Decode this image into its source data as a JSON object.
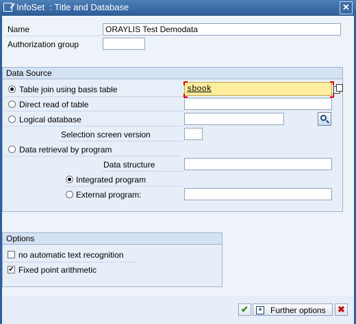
{
  "window": {
    "title": "InfoSet  : Title and Database",
    "close_symbol": "✕"
  },
  "header": {
    "name_label": "Name",
    "name_value": "ORAYLIS Test Demodata",
    "auth_label": "Authorization group",
    "auth_value": ""
  },
  "data_source": {
    "title": "Data Source",
    "table_join": {
      "label": "Table join using basis table",
      "value": "sbook",
      "selected": true
    },
    "direct_read": {
      "label": "Direct read of table",
      "value": "",
      "selected": false
    },
    "logical_db": {
      "label": "Logical database",
      "value": "",
      "selected": false
    },
    "selection_screen": {
      "label": "Selection screen version",
      "value": ""
    },
    "program": {
      "label": "Data retrieval by program",
      "selected": false
    },
    "data_structure": {
      "label": "Data structure",
      "value": ""
    },
    "integrated": {
      "label": "Integrated program",
      "selected": true
    },
    "external": {
      "label": "External program:",
      "value": "",
      "selected": false
    }
  },
  "options": {
    "title": "Options",
    "no_text_recognition": {
      "label": "no automatic text recognition",
      "checked": false
    },
    "fixed_point": {
      "label": "Fixed point arithmetic",
      "checked": true,
      "check_symbol": "✔"
    }
  },
  "footer": {
    "further_options_label": "Further options",
    "ok_symbol": "✔",
    "cancel_symbol": "✖"
  },
  "colors": {
    "title_bar": "#2f5f9a",
    "highlight_field": "#ffeea0",
    "ok_green": "#2e8b22",
    "cancel_red": "#c8101a"
  }
}
